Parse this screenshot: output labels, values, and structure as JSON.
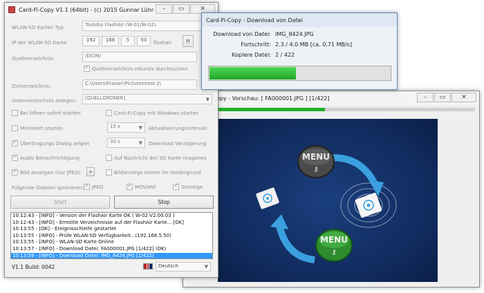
{
  "main_window": {
    "title": "Card-Fi-Copy V1.1 (64bit) - (c) 2015 Gunnar Lühr",
    "wlan_type_label": "WLAN-SD Karten Typ:",
    "wlan_type_value": "Toshiba FlashAir (W-01/W-02)",
    "ip_label": "IP der WLAN-SD Karte:",
    "ip_parts": [
      "192",
      "168",
      "5",
      "50"
    ],
    "ip_suffix": "flashair",
    "help_button": "H",
    "source_label": "Quellverzeichnis:",
    "source_value": "/DCIM/",
    "source_recursive": "Quellverzeichnis rekursiv durchsuchen",
    "target_label": "Zielverzeichnis:",
    "target_value": "C:\\Users\\Fraiser\\Pictures\\test-2\\",
    "subdir_label": "Unterverzeichnis anlegen:",
    "subdir_value": "[QUELLORDNER]",
    "opt_start_on_open": "Bei öffnen sofort starten",
    "opt_start_with_windows": "Card-Fi-Copy mit Windows starten",
    "opt_minimized": "Minimiert starten",
    "refresh_value": "15 s",
    "refresh_label": "Aktualisierungsintervall",
    "opt_show_dialog": "Übertragungs Dialog zeigen",
    "download_delay_value": "30 s",
    "download_delay_label": "Download Verzögerung",
    "opt_audio": "Audio Benachrichtigung",
    "opt_on_message": "Auf Nachricht der SD Karte reagieren",
    "opt_show_image": "Bild anzeigen (nur JPEG)",
    "plus_button": "+",
    "opt_foreground": "Bildanzeige immer im Vordergrund",
    "ignore_label": "Folgende Dateien ignorieren:",
    "ignore_jpeg": "JPEG",
    "ignore_mov": "MOV/AVI",
    "ignore_other": "Sonstige",
    "start_button": "Start",
    "stop_button": "Stop",
    "log_lines": [
      "10:12:43 - [INFO] - Version der FlashAir Karte OK ( W-02 V2.00.03 )",
      "10:12:43 - [INFO] - Ermittle Verzeichnisse auf der FlashAir Karte... [OK]",
      "10:13:55 - [OK] - Ereignisschleife gestartet",
      "10:13:55 - [INFO] - Prüfe WLAN-SD Verfügbarkeit...(192.168.5.50)",
      "10:13:55 - [INFO] - WLAN-SD Karte Online",
      "10:13:57 - [INFO] - Download Datei:  FA000001.JPG [1/422] (OK)",
      "10:13:59 - [INFO] - Download Datei:  IMG_8424.JPG [2/422]"
    ],
    "build_text": "V1.1 Build: 0042",
    "language": "Deutsch"
  },
  "download_window": {
    "title": "Card-Fi-Copy - Download von Datei",
    "file_label": "Download von Datei:",
    "file_value": "IMG_8424.JPG",
    "progress_label": "Fortschritt:",
    "progress_value": "2.3 / 4.0 MB [ca. 0.71 MB/s]",
    "copy_label": "Kopiere Datei:",
    "copy_value": "2 / 422",
    "progress_fraction": 0.48
  },
  "preview_window": {
    "title": "opy - Vorschau: [ FA000001.JPG ] [1/422]",
    "progress_fraction": 0.42,
    "menu_label_top": "MENU",
    "menu_label_bottom": "MENU"
  },
  "colors": {
    "progress_green": "#22b02c",
    "preview_bg": "#102a5c",
    "selected_row": "#3399ff"
  }
}
